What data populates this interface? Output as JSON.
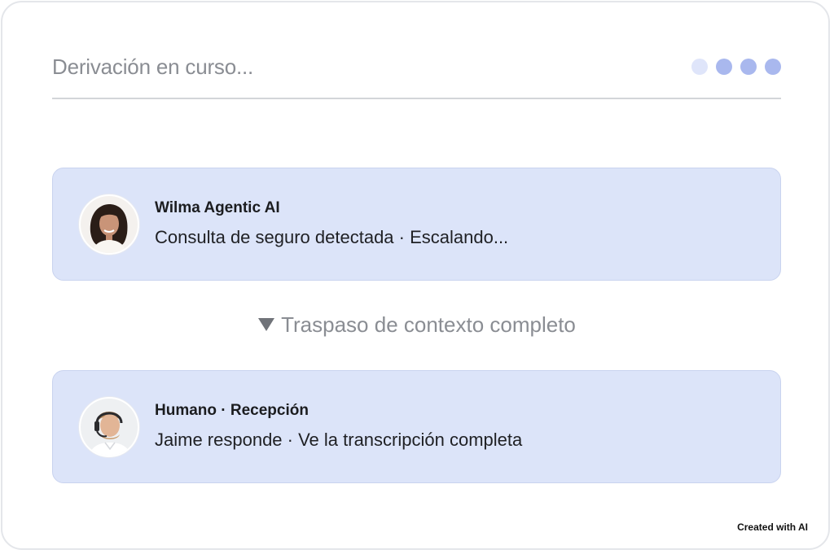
{
  "header": {
    "title": "Derivación en curso...",
    "progress_dots": {
      "total": 4,
      "completed": 3
    }
  },
  "cards": [
    {
      "name": "Wilma Agentic AI",
      "message": "Consulta de seguro detectada · Escalando...",
      "avatar_icon": "woman-avatar-icon"
    },
    {
      "name": "Humano · Recepción",
      "message": "Jaime responde · Ve la transcripción completa",
      "avatar_icon": "man-headset-avatar-icon"
    }
  ],
  "handoff": {
    "icon": "triangle-down-icon",
    "label": "Traspaso de contexto completo"
  },
  "footer": {
    "note": "Created with AI"
  },
  "colors": {
    "card_bg": "#dce4f9",
    "dot_active": "#a9b8ee",
    "dot_inactive": "#dfe5fa",
    "muted_text": "#8a8d93"
  }
}
